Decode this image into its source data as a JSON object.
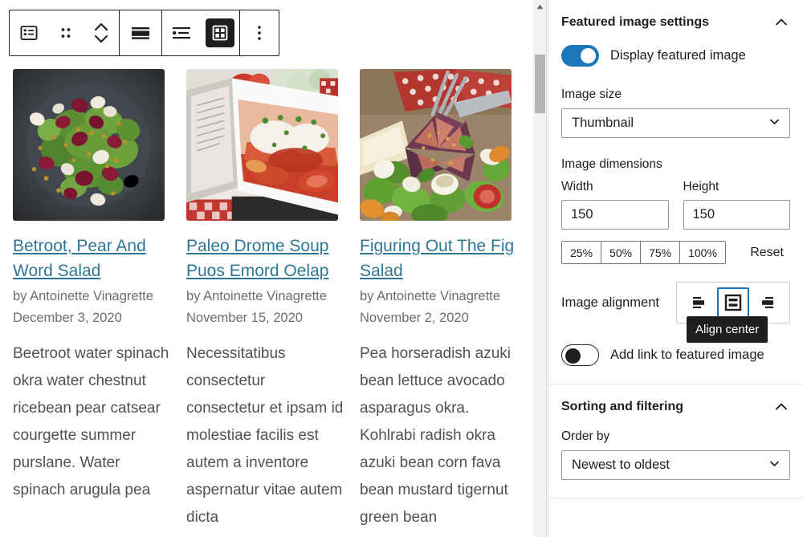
{
  "editor": {
    "toolbar": {
      "groups": [
        {
          "buttons": [
            {
              "name": "block-type-latest-posts-icon",
              "label": "Latest Posts block",
              "active": false
            },
            {
              "name": "drag-handle-icon",
              "label": "Drag",
              "active": false
            },
            {
              "name": "move-up-down-icon",
              "label": "Move up or down",
              "active": false
            }
          ]
        },
        {
          "buttons": [
            {
              "name": "align-icon",
              "label": "Align",
              "active": false
            }
          ]
        },
        {
          "buttons": [
            {
              "name": "list-view-icon",
              "label": "List view",
              "active": false
            },
            {
              "name": "grid-view-icon",
              "label": "Grid view",
              "active": true
            }
          ]
        },
        {
          "buttons": [
            {
              "name": "more-options-icon",
              "label": "Options",
              "active": false
            }
          ]
        }
      ]
    },
    "posts": [
      {
        "image_name": "beetroot-pear-salad-photo",
        "title": "Betroot, Pear And Word Salad",
        "byline": "by Antoinette Vinagrette",
        "date": "December 3, 2020",
        "excerpt": "Beetroot water spinach okra water chestnut ricebean pear catsear courgette summer purslane. Water spinach arugula pea"
      },
      {
        "image_name": "cookbook-soup-photo",
        "title": "Paleo Drome Soup Puos Emord Oelap",
        "byline": "by Antoinette Vinagrette",
        "date": "November 15, 2020",
        "excerpt": "Necessitatibus consectetur consectetur et ipsam id molestiae facilis est autem a inventore aspernatur vitae autem dicta"
      },
      {
        "image_name": "fig-salad-photo",
        "title": "Figuring Out The Fig Salad",
        "byline": "by Antoinette Vinagrette",
        "date": "November 2, 2020",
        "excerpt": "Pea horseradish azuki bean lettuce avocado asparagus okra. Kohlrabi radish okra azuki bean corn fava bean mustard tigernut green bean"
      }
    ],
    "scrollbar": {
      "name": "editor-vertical-scrollbar"
    }
  },
  "sidebar": {
    "featured_image_panel": {
      "title": "Featured image settings",
      "expanded": true,
      "display_featured_image": {
        "label": "Display featured image",
        "checked": true
      },
      "image_size": {
        "label": "Image size",
        "value": "Thumbnail"
      },
      "image_dimensions": {
        "label": "Image dimensions",
        "width_label": "Width",
        "width_value": "150",
        "height_label": "Height",
        "height_value": "150",
        "percent_buttons": [
          "25%",
          "50%",
          "75%",
          "100%"
        ],
        "reset_label": "Reset"
      },
      "image_alignment": {
        "label": "Image alignment",
        "options": [
          {
            "name": "align-left-icon",
            "label": "Align left",
            "selected": false
          },
          {
            "name": "align-center-icon",
            "label": "Align center",
            "selected": true
          },
          {
            "name": "align-right-icon",
            "label": "Align right",
            "selected": false
          }
        ],
        "tooltip": "Align center"
      },
      "add_link": {
        "label": "Add link to featured image",
        "checked": false
      }
    },
    "sorting_panel": {
      "title": "Sorting and filtering",
      "expanded": true,
      "order_by": {
        "label": "Order by",
        "value": "Newest to oldest"
      }
    }
  },
  "colors": {
    "accent": "#1b77ba",
    "link": "#2f7695",
    "text": "#1e1e1e",
    "muted": "#6d6d6d",
    "body": "#515151"
  }
}
